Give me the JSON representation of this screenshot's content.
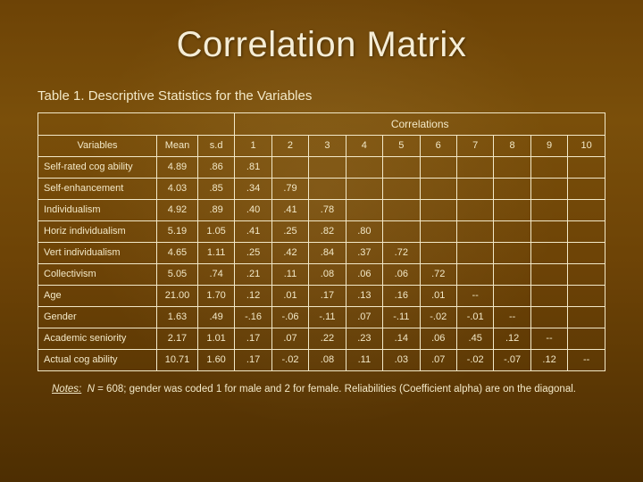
{
  "title": "Correlation Matrix",
  "caption": "Table 1. Descriptive Statistics for the Variables",
  "headers": {
    "correlations": "Correlations",
    "variables": "Variables",
    "mean": "Mean",
    "sd": "s.d"
  },
  "col_nums": [
    "1",
    "2",
    "3",
    "4",
    "5",
    "6",
    "7",
    "8",
    "9",
    "10"
  ],
  "rows": [
    {
      "name": "Self-rated cog ability",
      "mean": "4.89",
      "sd": ".86",
      "corr": [
        ".81",
        "",
        "",
        "",
        "",
        "",
        "",
        "",
        "",
        ""
      ]
    },
    {
      "name": "Self-enhancement",
      "mean": "4.03",
      "sd": ".85",
      "corr": [
        ".34",
        ".79",
        "",
        "",
        "",
        "",
        "",
        "",
        "",
        ""
      ]
    },
    {
      "name": "Individualism",
      "mean": "4.92",
      "sd": ".89",
      "corr": [
        ".40",
        ".41",
        ".78",
        "",
        "",
        "",
        "",
        "",
        "",
        ""
      ]
    },
    {
      "name": "Horiz individualism",
      "mean": "5.19",
      "sd": "1.05",
      "corr": [
        ".41",
        ".25",
        ".82",
        ".80",
        "",
        "",
        "",
        "",
        "",
        ""
      ]
    },
    {
      "name": "Vert individualism",
      "mean": "4.65",
      "sd": "1.11",
      "corr": [
        ".25",
        ".42",
        ".84",
        ".37",
        ".72",
        "",
        "",
        "",
        "",
        ""
      ]
    },
    {
      "name": "Collectivism",
      "mean": "5.05",
      "sd": ".74",
      "corr": [
        ".21",
        ".11",
        ".08",
        ".06",
        ".06",
        ".72",
        "",
        "",
        "",
        ""
      ]
    },
    {
      "name": "Age",
      "mean": "21.00",
      "sd": "1.70",
      "corr": [
        ".12",
        ".01",
        ".17",
        ".13",
        ".16",
        ".01",
        "--",
        "",
        "",
        ""
      ]
    },
    {
      "name": "Gender",
      "mean": "1.63",
      "sd": ".49",
      "corr": [
        "-.16",
        "-.06",
        "-.11",
        ".07",
        "-.11",
        "-.02",
        "-.01",
        "--",
        "",
        ""
      ]
    },
    {
      "name": "Academic seniority",
      "mean": "2.17",
      "sd": "1.01",
      "corr": [
        ".17",
        ".07",
        ".22",
        ".23",
        ".14",
        ".06",
        ".45",
        ".12",
        "--",
        ""
      ]
    },
    {
      "name": "Actual cog ability",
      "mean": "10.71",
      "sd": "1.60",
      "corr": [
        ".17",
        "-.02",
        ".08",
        ".11",
        ".03",
        ".07",
        "-.02",
        "-.07",
        ".12",
        "--"
      ]
    }
  ],
  "notes": {
    "label": "Notes:",
    "nlabel": "N",
    "text1": " = 608; gender was coded 1 for male and 2 for female. Reliabilities (Coefficient alpha) are on the diagonal."
  },
  "chart_data": {
    "type": "table",
    "title": "Correlation Matrix — Descriptive Statistics for the Variables",
    "n": 608,
    "variables": [
      "Self-rated cog ability",
      "Self-enhancement",
      "Individualism",
      "Horiz individualism",
      "Vert individualism",
      "Collectivism",
      "Age",
      "Gender",
      "Academic seniority",
      "Actual cog ability"
    ],
    "mean": [
      4.89,
      4.03,
      4.92,
      5.19,
      4.65,
      5.05,
      21.0,
      1.63,
      2.17,
      10.71
    ],
    "sd": [
      0.86,
      0.85,
      0.89,
      1.05,
      1.11,
      0.74,
      1.7,
      0.49,
      1.01,
      1.6
    ],
    "reliability_diagonal": [
      0.81,
      0.79,
      0.78,
      0.8,
      0.72,
      0.72,
      null,
      null,
      null,
      null
    ],
    "correlations_lower_triangle": {
      "2": {
        "1": 0.34
      },
      "3": {
        "1": 0.4,
        "2": 0.41
      },
      "4": {
        "1": 0.41,
        "2": 0.25,
        "3": 0.82
      },
      "5": {
        "1": 0.25,
        "2": 0.42,
        "3": 0.84,
        "4": 0.37
      },
      "6": {
        "1": 0.21,
        "2": 0.11,
        "3": 0.08,
        "4": 0.06,
        "5": 0.06
      },
      "7": {
        "1": 0.12,
        "2": 0.01,
        "3": 0.17,
        "4": 0.13,
        "5": 0.16,
        "6": 0.01
      },
      "8": {
        "1": -0.16,
        "2": -0.06,
        "3": -0.11,
        "4": 0.07,
        "5": -0.11,
        "6": -0.02,
        "7": -0.01
      },
      "9": {
        "1": 0.17,
        "2": 0.07,
        "3": 0.22,
        "4": 0.23,
        "5": 0.14,
        "6": 0.06,
        "7": 0.45,
        "8": 0.12
      },
      "10": {
        "1": 0.17,
        "2": -0.02,
        "3": 0.08,
        "4": 0.11,
        "5": 0.03,
        "6": 0.07,
        "7": -0.02,
        "8": -0.07,
        "9": 0.12
      }
    },
    "gender_coding": {
      "1": "male",
      "2": "female"
    }
  }
}
